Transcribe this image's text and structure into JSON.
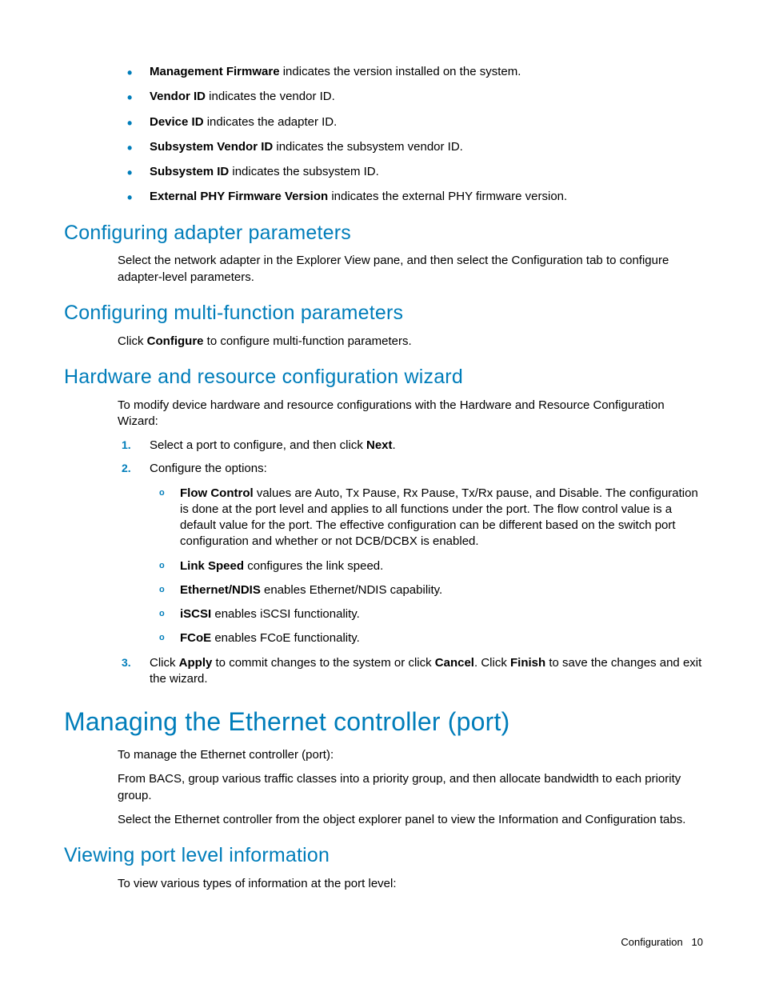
{
  "bullets_top": [
    {
      "term": "Management Firmware",
      "rest": " indicates the version installed on the system."
    },
    {
      "term": "Vendor ID",
      "rest": " indicates the vendor ID."
    },
    {
      "term": "Device ID",
      "rest": " indicates the adapter ID."
    },
    {
      "term": "Subsystem Vendor ID",
      "rest": " indicates the subsystem vendor ID."
    },
    {
      "term": "Subsystem ID",
      "rest": " indicates the subsystem ID."
    },
    {
      "term": "External PHY Firmware Version",
      "rest": " indicates the external PHY firmware version."
    }
  ],
  "h_adapter": "Configuring adapter parameters",
  "p_adapter": "Select the network adapter in the Explorer View pane, and then select the Configuration tab to configure adapter-level parameters.",
  "h_multi": "Configuring multi-function parameters",
  "p_multi_pre": "Click ",
  "p_multi_bold": "Configure",
  "p_multi_post": " to configure multi-function parameters.",
  "h_hw": "Hardware and resource configuration wizard",
  "p_hw_intro": "To modify device hardware and resource configurations with the Hardware and Resource Configuration Wizard:",
  "ol1_pre": "Select a port to configure, and then click ",
  "ol1_bold": "Next",
  "ol1_post": ".",
  "ol2": "Configure the options:",
  "sub": [
    {
      "term": "Flow Control",
      "rest": " values are Auto, Tx Pause, Rx Pause, Tx/Rx pause, and Disable. The configuration is done at the port level and applies to all functions under the port. The flow control value is a default value for the port. The effective configuration can be different based on the switch port configuration and whether or not DCB/DCBX is enabled."
    },
    {
      "term": "Link Speed",
      "rest": " configures the link speed."
    },
    {
      "term": "Ethernet/NDIS",
      "rest": " enables Ethernet/NDIS capability."
    },
    {
      "term": "iSCSI",
      "rest": " enables iSCSI functionality."
    },
    {
      "term": "FCoE",
      "rest": " enables FCoE functionality."
    }
  ],
  "ol3_1": "Click ",
  "ol3_2": "Apply",
  "ol3_3": " to commit changes to the system or click ",
  "ol3_4": "Cancel",
  "ol3_5": ". Click ",
  "ol3_6": "Finish",
  "ol3_7": " to save the changes and exit the wizard.",
  "h_managing": "Managing the Ethernet controller (port)",
  "p_man1": "To manage the Ethernet controller (port):",
  "p_man2": "From BACS, group various traffic classes into a priority group, and then allocate bandwidth to each priority group.",
  "p_man3": "Select the Ethernet controller from the object explorer panel to view the Information and Configuration tabs.",
  "h_viewing": "Viewing port level information",
  "p_viewing": "To view various types of information at the port level:",
  "footer_section": "Configuration",
  "footer_page": "10"
}
